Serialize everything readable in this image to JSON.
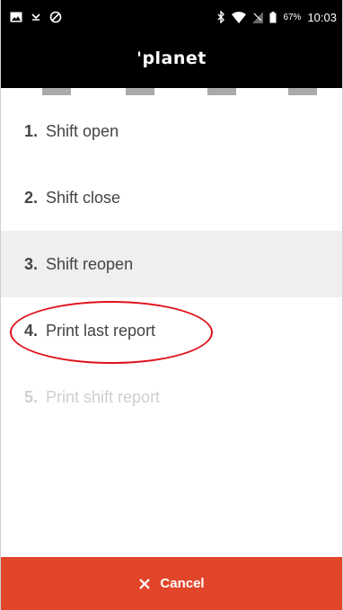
{
  "status_bar": {
    "icons_left": [
      "gallery-icon",
      "missed-call-icon",
      "no-signal-icon"
    ],
    "icons_right": [
      "bluetooth-icon",
      "wifi-icon",
      "sim-icon",
      "battery-icon"
    ],
    "battery_percent": "67%",
    "time": "10:03"
  },
  "header": {
    "brand": "'planet"
  },
  "steps": {
    "count": 4
  },
  "menu": {
    "items": [
      {
        "number": "1.",
        "label": "Shift open",
        "state": "normal"
      },
      {
        "number": "2.",
        "label": "Shift close",
        "state": "normal"
      },
      {
        "number": "3.",
        "label": "Shift reopen",
        "state": "highlighted"
      },
      {
        "number": "4.",
        "label": "Print last report",
        "state": "normal"
      },
      {
        "number": "5.",
        "label": "Print shift report",
        "state": "disabled"
      }
    ]
  },
  "cancel": {
    "icon": "close-icon",
    "label": "Cancel"
  },
  "colors": {
    "accent": "#e2462a",
    "annotation": "#e0121b",
    "header_bg": "#000000"
  }
}
